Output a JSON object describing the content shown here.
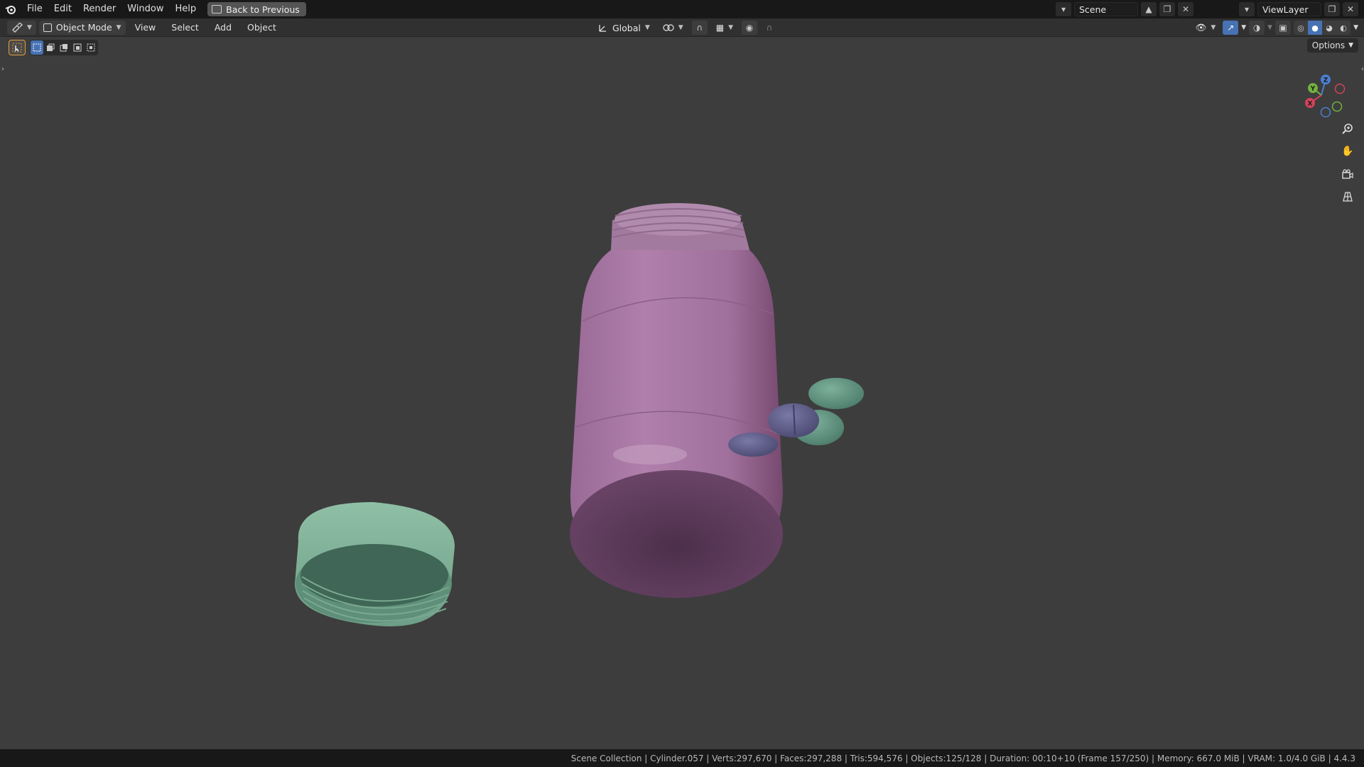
{
  "topbar": {
    "menus": [
      "File",
      "Edit",
      "Render",
      "Window",
      "Help"
    ],
    "back_button": "Back to Previous",
    "scene_name": "Scene",
    "view_layer": "ViewLayer"
  },
  "header": {
    "mode": "Object Mode",
    "menus": [
      "View",
      "Select",
      "Add",
      "Object"
    ],
    "transform_orientation": "Global",
    "options_label": "Options"
  },
  "gizmo": {
    "x": "X",
    "y": "Y",
    "z": "Z"
  },
  "status": "Scene Collection | Cylinder.057 | Verts:297,670 | Faces:297,288 | Tris:594,576 | Objects:125/128 | Duration: 00:10+10 (Frame 157/250) | Memory: 667.0 MiB | VRAM: 1.0/4.0 GiB | 4.4.3",
  "icons": [
    "blender-logo",
    "editor-type-icon",
    "object-mode-icon",
    "select-box-icon",
    "transform-orientation-icon",
    "pivot-icon",
    "snap-icon",
    "proportional-edit-icon",
    "visibility-icon",
    "gizmo-icon",
    "overlay-icon",
    "xray-icon",
    "shading-wireframe-icon",
    "shading-solid-icon",
    "shading-material-icon",
    "shading-rendered-icon",
    "zoom-icon",
    "pan-hand-icon",
    "camera-icon",
    "ortho-grid-icon"
  ]
}
